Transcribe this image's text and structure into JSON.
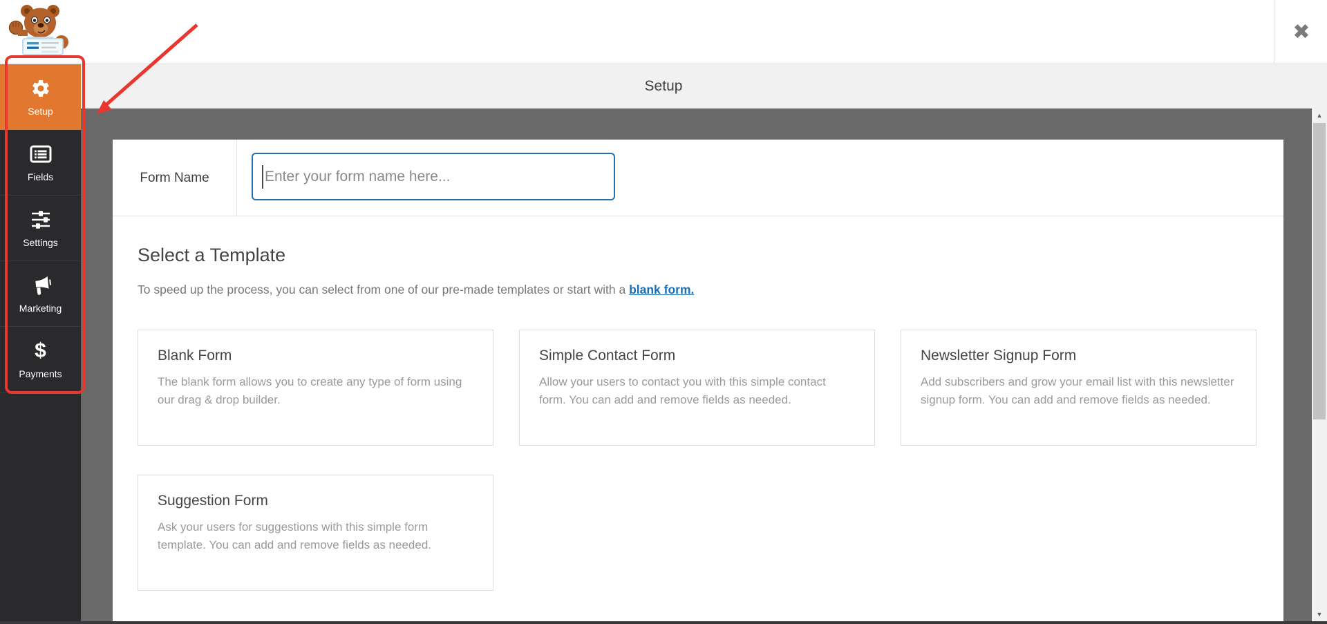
{
  "header": {
    "close_icon": "✖"
  },
  "topbar": {
    "title": "Setup"
  },
  "sidebar": {
    "items": [
      {
        "label": "Setup",
        "icon": "gear-icon",
        "active": true
      },
      {
        "label": "Fields",
        "icon": "fields-icon",
        "active": false
      },
      {
        "label": "Settings",
        "icon": "sliders-icon",
        "active": false
      },
      {
        "label": "Marketing",
        "icon": "megaphone-icon",
        "active": false
      },
      {
        "label": "Payments",
        "icon": "dollar-icon",
        "active": false
      }
    ],
    "dollar_glyph": "$"
  },
  "form_name": {
    "label": "Form Name",
    "placeholder": "Enter your form name here..."
  },
  "templates": {
    "heading": "Select a Template",
    "intro_text": "To speed up the process, you can select from one of our pre-made templates or start with a ",
    "intro_link": "blank form.",
    "cards": [
      {
        "title": "Blank Form",
        "description": "The blank form allows you to create any type of form using our drag & drop builder."
      },
      {
        "title": "Simple Contact Form",
        "description": "Allow your users to contact you with this simple contact form. You can add and remove fields as needed."
      },
      {
        "title": "Newsletter Signup Form",
        "description": "Add subscribers and grow your email list with this newsletter signup form. You can add and remove fields as needed."
      },
      {
        "title": "Suggestion Form",
        "description": "Ask your users for suggestions with this simple form template. You can add and remove fields as needed."
      }
    ]
  },
  "scrollbar": {
    "up_glyph": "▲",
    "down_glyph": "▼"
  },
  "colors": {
    "accent_orange": "#e27730",
    "sidebar_dark": "#2a2a2c",
    "content_gray": "#696969",
    "annotation_red": "#e8372e",
    "link_blue": "#1a6fb5",
    "input_border_blue": "#2271b1"
  }
}
